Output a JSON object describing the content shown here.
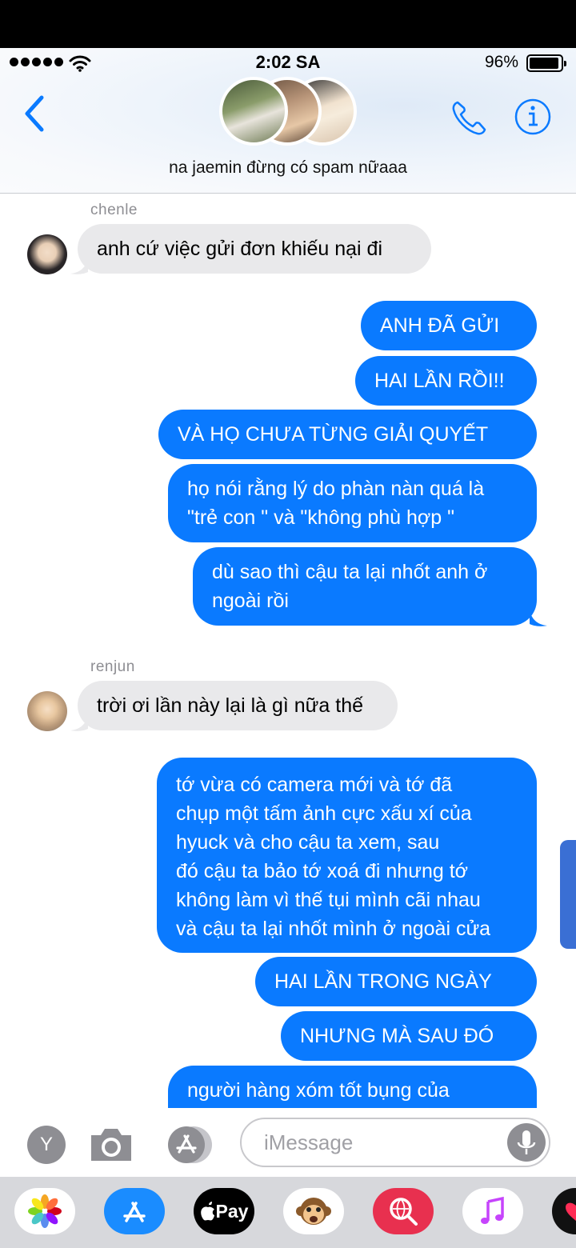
{
  "status": {
    "time": "2:02 SA",
    "battery": "96%"
  },
  "header": {
    "title": "na jaemin đừng có spam nữaaa"
  },
  "messages": {
    "chenle_name": "chenle",
    "chenle_msg": "anh cứ việc gửi đơn khiếu nại đi",
    "out1": "ANH ĐÃ GỬI",
    "out2": "HAI LẦN RỒI!!",
    "out3": "VÀ HỌ CHƯA TỪNG GIẢI QUYẾT",
    "out4_l1": "họ nói rằng lý do phàn nàn quá là",
    "out4_l2": "\"trẻ con \" và \"không phù hợp \"",
    "out5_l1": "dù sao thì cậu ta lại nhốt anh ở",
    "out5_l2": "ngoài rồi",
    "renjun_name": "renjun",
    "renjun_msg": "trời ơi lần này lại là gì nữa thế",
    "out6_l1": "tớ vừa có camera mới và tớ đã",
    "out6_l2": "chụp một tấm ảnh cực xấu xí của",
    "out6_l3": "hyuck và cho cậu ta xem, sau",
    "out6_l4": "đó cậu ta bảo tớ xoá đi nhưng tớ",
    "out6_l5": "không làm vì thế tụi mình cãi nhau",
    "out6_l6": "và cậu ta lại nhốt mình ở ngoài cửa",
    "out7": "HAI LẦN TRONG NGÀY",
    "out8": "NHƯNG MÀ SAU ĐÓ",
    "out9": "người hàng xóm tốt bụng của"
  },
  "input": {
    "y_label": "Y",
    "placeholder": "iMessage"
  },
  "dock": {
    "pay_label": "Pay"
  },
  "colors": {
    "accent": "#0a7aff",
    "incoming": "#e9e9eb"
  },
  "icons": [
    "back-chevron-icon",
    "phone-icon",
    "info-icon",
    "camera-icon",
    "app-store-icon",
    "mic-icon",
    "photos-icon",
    "apple-pay-icon",
    "animoji-icon",
    "search-globe-icon",
    "music-icon"
  ]
}
